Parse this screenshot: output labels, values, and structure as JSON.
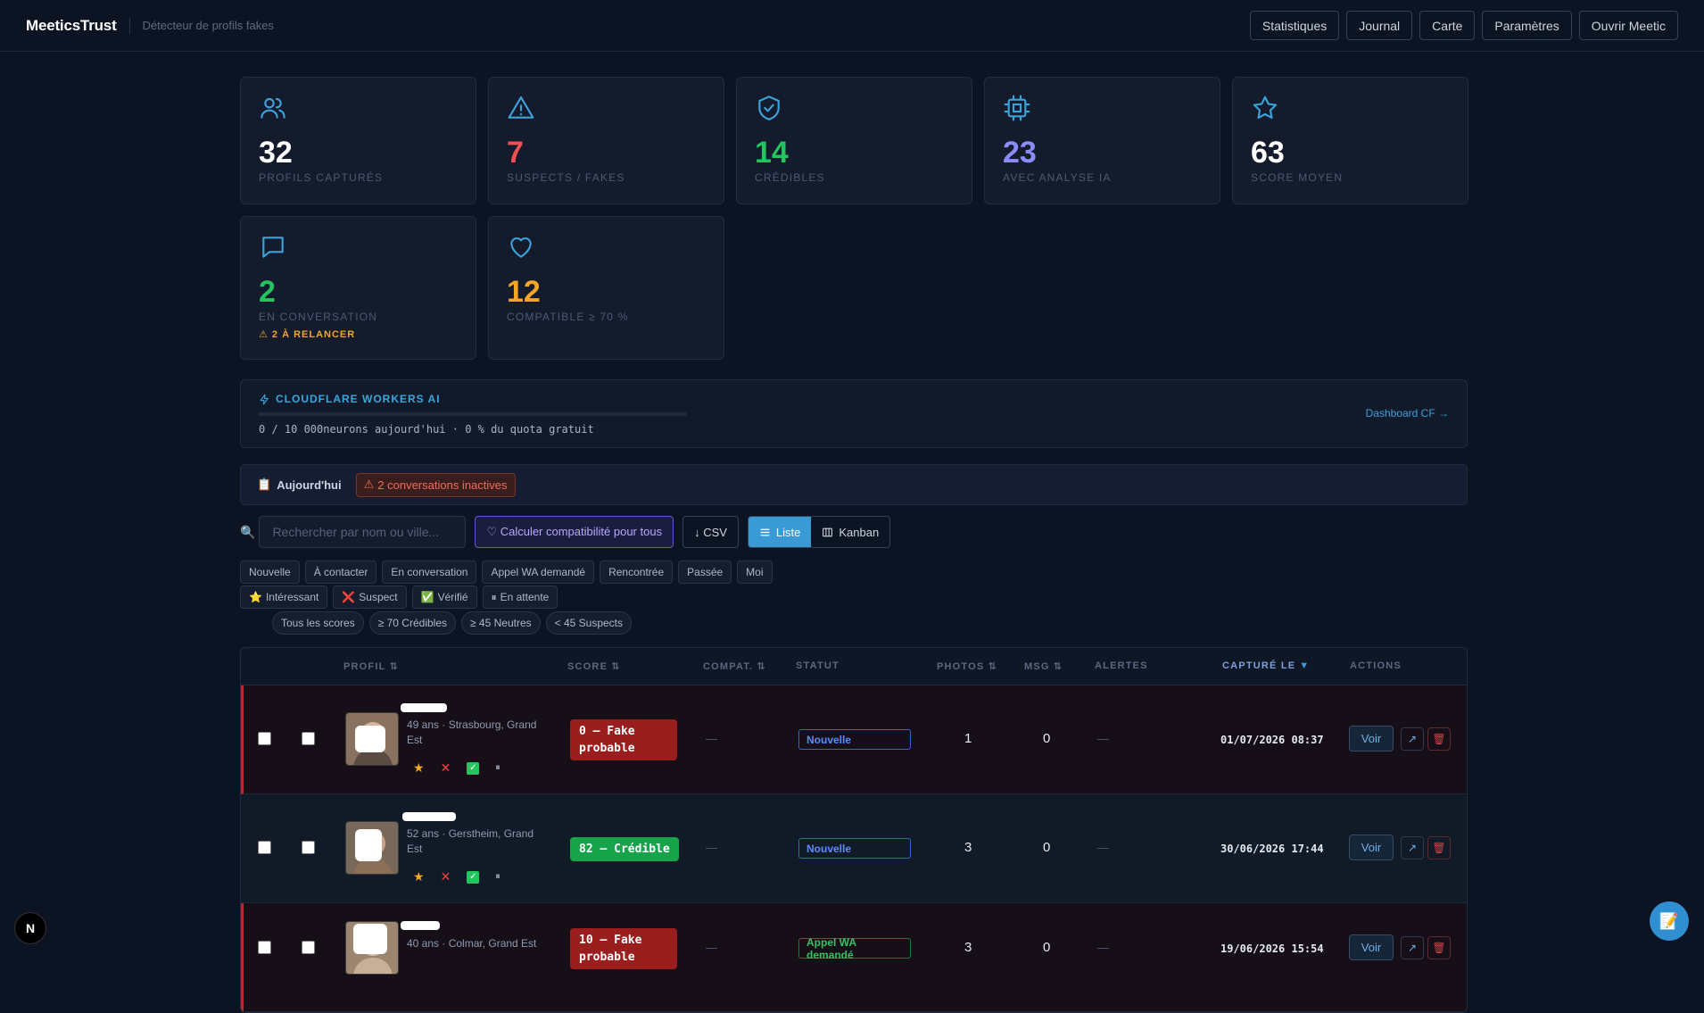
{
  "header": {
    "brand": "MeeticsTrust",
    "subtitle": "Détecteur de profils fakes",
    "nav": [
      "Statistiques",
      "Journal",
      "Carte",
      "Paramètres",
      "Ouvrir Meetic"
    ]
  },
  "stats": [
    {
      "icon": "users-icon",
      "value": "32",
      "label": "PROFILS CAPTURÉS",
      "color": "#ffffff"
    },
    {
      "icon": "warning-triangle-icon",
      "value": "7",
      "label": "SUSPECTS / FAKES",
      "color": "#f05252"
    },
    {
      "icon": "shield-check-icon",
      "value": "14",
      "label": "CRÉDIBLES",
      "color": "#22c55e"
    },
    {
      "icon": "cpu-icon",
      "value": "23",
      "label": "AVEC ANALYSE IA",
      "color": "#8b8cf7"
    },
    {
      "icon": "star-icon",
      "value": "63",
      "label": "SCORE MOYEN",
      "color": "#ffffff"
    },
    {
      "icon": "chat-icon",
      "value": "2",
      "label": "EN CONVERSATION",
      "warning": "⚠ 2 À RELANCER",
      "color": "#22c55e"
    },
    {
      "icon": "heart-icon",
      "value": "12",
      "label": "COMPATIBLE ≥ 70 %",
      "color": "#f5a623"
    }
  ],
  "cloudflare": {
    "title": "CLOUDFLARE WORKERS AI",
    "usage_text": "0 / 10 000neurons aujourd'hui · 0 % du quota gratuit",
    "quota_fraction": 0,
    "link": "Dashboard CF →"
  },
  "today": {
    "label": "Aujourd'hui",
    "badge": "2 conversations inactives"
  },
  "toolbar": {
    "search_placeholder": "Rechercher par nom ou ville...",
    "compat_button": "♡ Calculer compatibilité pour tous",
    "csv_button": "↓ CSV",
    "view_list": "Liste",
    "view_kanban": "Kanban"
  },
  "filters": {
    "status": [
      "Nouvelle",
      "À contacter",
      "En conversation",
      "Appel WA demandé",
      "Rencontrée",
      "Passée",
      "Moi"
    ],
    "tags": [
      {
        "icon": "⭐",
        "label": "Intéressant"
      },
      {
        "icon": "❌",
        "label": "Suspect"
      },
      {
        "icon": "✅",
        "label": "Vérifié"
      },
      {
        "icon": "⏸",
        "label": "En attente"
      }
    ],
    "scores": [
      "Tous les scores",
      "≥ 70 Crédibles",
      "≥ 45 Neutres",
      "< 45 Suspects"
    ]
  },
  "table": {
    "headers": {
      "profile": "PROFIL",
      "score": "SCORE",
      "compat": "COMPAT.",
      "status": "STATUT",
      "photos": "PHOTOS",
      "msg": "MSG",
      "alerts": "ALERTES",
      "captured": "CAPTURÉ LE",
      "actions": "ACTIONS"
    },
    "rows": [
      {
        "meta": "49 ans · Strasbourg, Grand Est",
        "score": "0 — Fake probable",
        "score_kind": "red",
        "compat": "—",
        "status": "Nouvelle",
        "status_kind": "blue",
        "photos": "1",
        "msg": "0",
        "alerts": "—",
        "captured": "01/07/2026 08:37",
        "view": "Voir"
      },
      {
        "meta": "52 ans · Gerstheim, Grand Est",
        "score": "82 — Crédible",
        "score_kind": "green",
        "compat": "—",
        "status": "Nouvelle",
        "status_kind": "blue",
        "photos": "3",
        "msg": "0",
        "alerts": "—",
        "captured": "30/06/2026 17:44",
        "view": "Voir"
      },
      {
        "meta": "40 ans · Colmar, Grand Est",
        "score": "10 — Fake probable",
        "score_kind": "red",
        "compat": "—",
        "status": "Appel WA demandé",
        "status_kind": "green",
        "photos": "3",
        "msg": "0",
        "alerts": "—",
        "captured": "19/06/2026 15:54",
        "view": "Voir"
      }
    ]
  },
  "colors": {
    "accent": "#38a7db",
    "danger": "#b42c2c",
    "success": "#16a34a"
  }
}
